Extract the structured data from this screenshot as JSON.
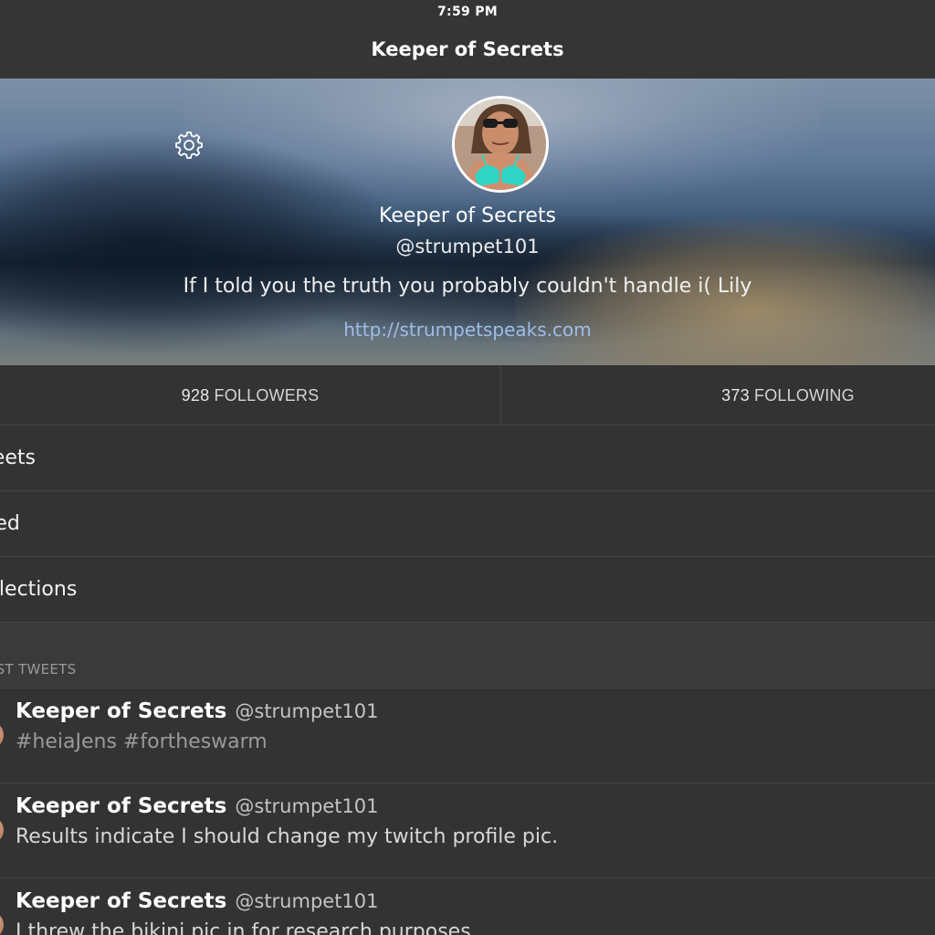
{
  "status_bar": {
    "time": "7:59 PM"
  },
  "nav": {
    "title": "Keeper of Secrets"
  },
  "profile": {
    "name": "Keeper of Secrets",
    "handle": "@strumpet101",
    "bio": "If I told you the truth you probably couldn't handle i( Lily",
    "link": "http://strumpetspeaks.com",
    "settings_icon": "gear-icon"
  },
  "stats": {
    "followers_count": "928",
    "followers_label": "FOLLOWERS",
    "following_count": "373",
    "following_label": "FOLLOWING"
  },
  "menu": {
    "items": [
      {
        "label": "Tweets"
      },
      {
        "label": "Liked"
      },
      {
        "label": "Collections"
      }
    ]
  },
  "section": {
    "label": "LATEST TWEETS"
  },
  "tweets": [
    {
      "name": "Keeper of Secrets",
      "handle": "@strumpet101",
      "text": "#heiaJens #fortheswarm"
    },
    {
      "name": "Keeper of Secrets",
      "handle": "@strumpet101",
      "text": "Results indicate I should change my twitch profile pic."
    },
    {
      "name": "Keeper of Secrets",
      "handle": "@strumpet101",
      "text": "I threw the bikini pic in for research purposes"
    }
  ],
  "colors": {
    "background": "#323232",
    "link": "#9fbde8",
    "hashtag_text": "#9a9a9a"
  }
}
